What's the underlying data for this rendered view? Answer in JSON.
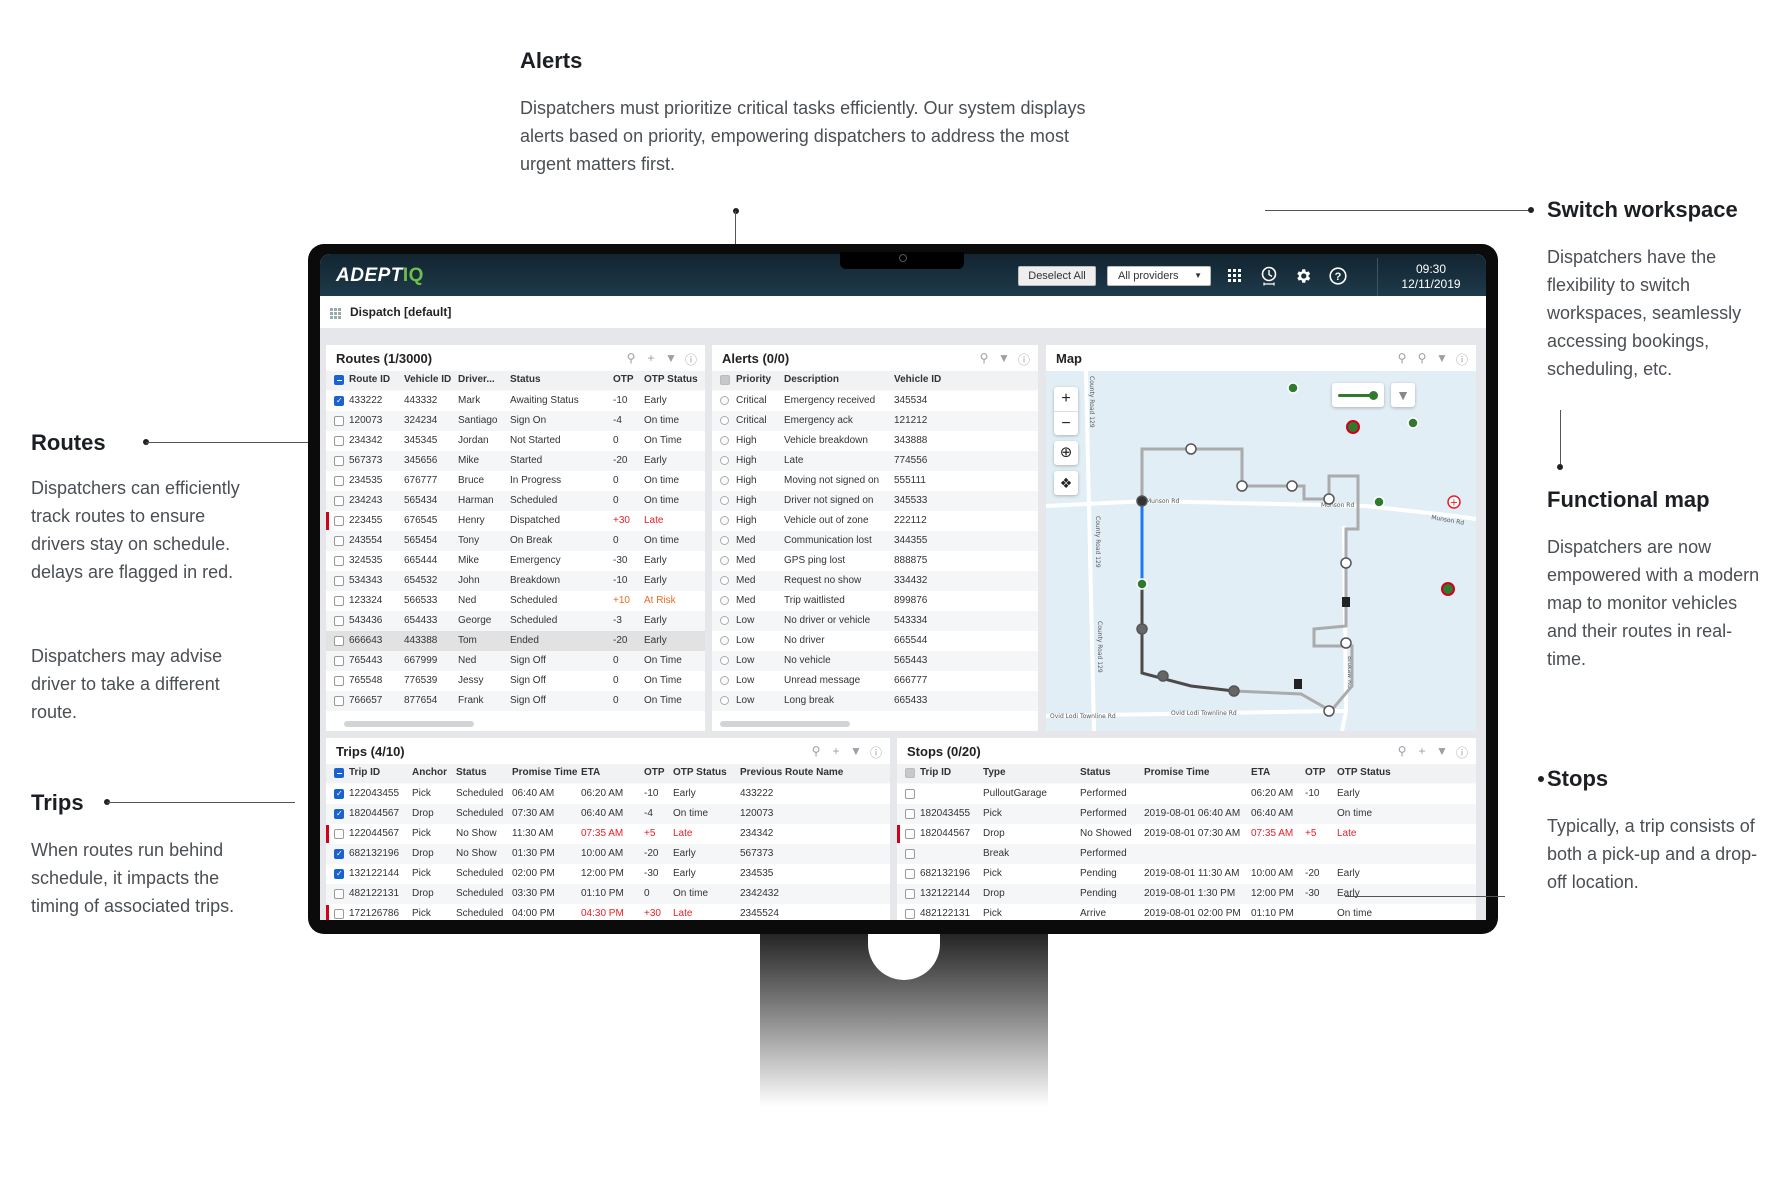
{
  "annotations": {
    "alerts": {
      "title": "Alerts",
      "body": "Dispatchers must prioritize critical tasks efficiently. Our system displays alerts based on priority, empowering dispatchers to address the most urgent matters first."
    },
    "switch_workspace": {
      "title": "Switch workspace",
      "body": "Dispatchers have the flexibility to switch workspaces, seamlessly accessing bookings, scheduling, etc."
    },
    "functional_map": {
      "title": "Functional map",
      "body": "Dispatchers are now empowered with a modern map to monitor vehicles and their routes in real-time."
    },
    "routes": {
      "title": "Routes",
      "body1": "Dispatchers can efficiently track routes to ensure drivers stay on schedule. delays are flagged in red.",
      "body2": "Dispatchers may advise driver to take a different route."
    },
    "trips": {
      "title": "Trips",
      "body": "When routes run behind schedule, it impacts the timing of associated trips."
    },
    "stops": {
      "title": "Stops",
      "body": "Typically, a trip consists of both a pick-up and a drop-off location."
    }
  },
  "header": {
    "logo_main": "ADEPT",
    "logo_accent": "IQ",
    "deselect_all": "Deselect All",
    "providers": "All providers",
    "time": "09:30",
    "date": "12/11/2019",
    "icons": [
      "apps-grid-icon",
      "timeline-clock-icon",
      "gear-icon",
      "help-icon"
    ]
  },
  "workspace": {
    "title": "Dispatch [default]"
  },
  "colors": {
    "accent": "#6cc04a",
    "late": "#e8202a",
    "at_risk": "#f06a1d",
    "selected": "#1b62d1",
    "header_bg": "#1a3140"
  },
  "routes": {
    "title": "Routes (1/3000)",
    "columns": [
      "Route ID",
      "Vehicle ID",
      "Driver...",
      "Status",
      "OTP",
      "OTP Status"
    ],
    "rows": [
      {
        "checked": true,
        "flag": false,
        "id": "433222",
        "vehicle": "443332",
        "driver": "Mark",
        "status": "Awaiting Status",
        "otp": "-10",
        "otp_status": "Early",
        "tone": ""
      },
      {
        "checked": false,
        "flag": false,
        "id": "120073",
        "vehicle": "324234",
        "driver": "Santiago",
        "status": "Sign On",
        "otp": "-4",
        "otp_status": "On time",
        "tone": ""
      },
      {
        "checked": false,
        "flag": false,
        "id": "234342",
        "vehicle": "345345",
        "driver": "Jordan",
        "status": "Not Started",
        "otp": "0",
        "otp_status": "On Time",
        "tone": ""
      },
      {
        "checked": false,
        "flag": false,
        "id": "567373",
        "vehicle": "345656",
        "driver": "Mike",
        "status": "Started",
        "otp": "-20",
        "otp_status": "Early",
        "tone": ""
      },
      {
        "checked": false,
        "flag": false,
        "id": "234535",
        "vehicle": "676777",
        "driver": "Bruce",
        "status": "In Progress",
        "otp": "0",
        "otp_status": "On time",
        "tone": ""
      },
      {
        "checked": false,
        "flag": false,
        "id": "234243",
        "vehicle": "565434",
        "driver": "Harman",
        "status": "Scheduled",
        "otp": "0",
        "otp_status": "On time",
        "tone": ""
      },
      {
        "checked": false,
        "flag": true,
        "id": "223455",
        "vehicle": "676545",
        "driver": "Henry",
        "status": "Dispatched",
        "otp": "+30",
        "otp_status": "Late",
        "tone": "late"
      },
      {
        "checked": false,
        "flag": false,
        "id": "243554",
        "vehicle": "565454",
        "driver": "Tony",
        "status": "On Break",
        "otp": "0",
        "otp_status": "On time",
        "tone": ""
      },
      {
        "checked": false,
        "flag": false,
        "id": "324535",
        "vehicle": "665444",
        "driver": "Mike",
        "status": "Emergency",
        "otp": "-30",
        "otp_status": "Early",
        "tone": ""
      },
      {
        "checked": false,
        "flag": false,
        "id": "534343",
        "vehicle": "654532",
        "driver": "John",
        "status": "Breakdown",
        "otp": "-10",
        "otp_status": "Early",
        "tone": ""
      },
      {
        "checked": false,
        "flag": false,
        "id": "123324",
        "vehicle": "566533",
        "driver": "Ned",
        "status": "Scheduled",
        "otp": "+10",
        "otp_status": "At Risk",
        "tone": "risk"
      },
      {
        "checked": false,
        "flag": false,
        "id": "543436",
        "vehicle": "654433",
        "driver": "George",
        "status": "Scheduled",
        "otp": "-3",
        "otp_status": "Early",
        "tone": ""
      },
      {
        "checked": false,
        "flag": false,
        "id": "666643",
        "vehicle": "443388",
        "driver": "Tom",
        "status": "Ended",
        "otp": "-20",
        "otp_status": "Early",
        "tone": "",
        "ended": true
      },
      {
        "checked": false,
        "flag": false,
        "id": "765443",
        "vehicle": "667999",
        "driver": "Ned",
        "status": "Sign Off",
        "otp": "0",
        "otp_status": "On Time",
        "tone": ""
      },
      {
        "checked": false,
        "flag": false,
        "id": "765548",
        "vehicle": "776539",
        "driver": "Jessy",
        "status": "Sign Off",
        "otp": "0",
        "otp_status": "On Time",
        "tone": ""
      },
      {
        "checked": false,
        "flag": false,
        "id": "766657",
        "vehicle": "877654",
        "driver": "Frank",
        "status": "Sign Off",
        "otp": "0",
        "otp_status": "On Time",
        "tone": ""
      }
    ]
  },
  "alerts": {
    "title": "Alerts (0/0)",
    "columns": [
      "Priority",
      "Description",
      "Vehicle ID"
    ],
    "rows": [
      {
        "priority": "Critical",
        "description": "Emergency received",
        "vehicle": "345534"
      },
      {
        "priority": "Critical",
        "description": "Emergency ack",
        "vehicle": "121212"
      },
      {
        "priority": "High",
        "description": "Vehicle breakdown",
        "vehicle": "343888"
      },
      {
        "priority": "High",
        "description": "Late",
        "vehicle": "774556"
      },
      {
        "priority": "High",
        "description": "Moving not signed on",
        "vehicle": "555111"
      },
      {
        "priority": "High",
        "description": "Driver not signed on",
        "vehicle": "345533"
      },
      {
        "priority": "High",
        "description": "Vehicle out of zone",
        "vehicle": "222112"
      },
      {
        "priority": "Med",
        "description": "Communication lost",
        "vehicle": "344355"
      },
      {
        "priority": "Med",
        "description": "GPS ping lost",
        "vehicle": "888875"
      },
      {
        "priority": "Med",
        "description": "Request no show",
        "vehicle": "334432"
      },
      {
        "priority": "Med",
        "description": "Trip waitlisted",
        "vehicle": "899876"
      },
      {
        "priority": "Low",
        "description": "No driver or vehicle",
        "vehicle": "543334"
      },
      {
        "priority": "Low",
        "description": "No driver",
        "vehicle": "665544"
      },
      {
        "priority": "Low",
        "description": "No vehicle",
        "vehicle": "565443"
      },
      {
        "priority": "Low",
        "description": "Unread message",
        "vehicle": "666777"
      },
      {
        "priority": "Low",
        "description": "Long break",
        "vehicle": "665433"
      }
    ]
  },
  "map": {
    "title": "Map",
    "zoom_in": "+",
    "zoom_out": "−",
    "roads": {
      "munson": "Munson Rd",
      "county": "County Road 129",
      "ovid": "Ovid Lodi Townline Rd",
      "brokaw": "Brokaw Rd"
    }
  },
  "trips": {
    "title": "Trips (4/10)",
    "columns": [
      "Trip ID",
      "Anchor",
      "Status",
      "Promise Time",
      "ETA",
      "OTP",
      "OTP Status",
      "Previous Route Name"
    ],
    "rows": [
      {
        "checked": true,
        "flag": false,
        "id": "122043455",
        "anchor": "Pick",
        "status": "Scheduled",
        "promise": "06:40 AM",
        "eta": "06:20 AM",
        "otp": "-10",
        "otp_status": "Early",
        "prev": "433222",
        "tone": ""
      },
      {
        "checked": true,
        "flag": false,
        "id": "182044567",
        "anchor": "Drop",
        "status": "Scheduled",
        "promise": "07:30 AM",
        "eta": "06:40 AM",
        "otp": "-4",
        "otp_status": "On time",
        "prev": "120073",
        "tone": ""
      },
      {
        "checked": false,
        "flag": true,
        "id": "122044567",
        "anchor": "Pick",
        "status": "No Show",
        "promise": "11:30 AM",
        "eta": "07:35 AM",
        "otp": "+5",
        "otp_status": "Late",
        "prev": "234342",
        "tone": "late"
      },
      {
        "checked": true,
        "flag": false,
        "id": "682132196",
        "anchor": "Drop",
        "status": "No Show",
        "promise": "01:30 PM",
        "eta": "10:00 AM",
        "otp": "-20",
        "otp_status": "Early",
        "prev": "567373",
        "tone": ""
      },
      {
        "checked": true,
        "flag": false,
        "id": "132122144",
        "anchor": "Pick",
        "status": "Scheduled",
        "promise": "02:00 PM",
        "eta": "12:00 PM",
        "otp": "-30",
        "otp_status": "Early",
        "prev": "234535",
        "tone": ""
      },
      {
        "checked": false,
        "flag": false,
        "id": "482122131",
        "anchor": "Drop",
        "status": "Scheduled",
        "promise": "03:30 PM",
        "eta": "01:10 PM",
        "otp": "0",
        "otp_status": "On time",
        "prev": "2342432",
        "tone": ""
      },
      {
        "checked": false,
        "flag": true,
        "id": "172126786",
        "anchor": "Pick",
        "status": "Scheduled",
        "promise": "04:00 PM",
        "eta": "04:30 PM",
        "otp": "+30",
        "otp_status": "Late",
        "prev": "2345524",
        "tone": "late"
      }
    ]
  },
  "stops": {
    "title": "Stops (0/20)",
    "columns": [
      "Trip ID",
      "Type",
      "Status",
      "Promise Time",
      "ETA",
      "OTP",
      "OTP Status"
    ],
    "rows": [
      {
        "flag": false,
        "id": "",
        "type": "PulloutGarage",
        "status": "Performed",
        "promise": "",
        "eta": "06:20 AM",
        "otp": "-10",
        "otp_status": "Early",
        "tone": ""
      },
      {
        "flag": false,
        "id": "182043455",
        "type": "Pick",
        "status": "Performed",
        "promise": "2019-08-01 06:40 AM",
        "eta": "06:40 AM",
        "otp": "",
        "otp_status": "On time",
        "tone": ""
      },
      {
        "flag": true,
        "id": "182044567",
        "type": "Drop",
        "status": "No Showed",
        "promise": "2019-08-01 07:30 AM",
        "eta": "07:35 AM",
        "otp": "+5",
        "otp_status": "Late",
        "tone": "late"
      },
      {
        "flag": false,
        "id": "",
        "type": "Break",
        "status": "Performed",
        "promise": "",
        "eta": "",
        "otp": "",
        "otp_status": "",
        "tone": ""
      },
      {
        "flag": false,
        "id": "682132196",
        "type": "Pick",
        "status": "Pending",
        "promise": "2019-08-01 11:30 AM",
        "eta": "10:00 AM",
        "otp": "-20",
        "otp_status": "Early",
        "tone": ""
      },
      {
        "flag": false,
        "id": "132122144",
        "type": "Drop",
        "status": "Pending",
        "promise": "2019-08-01 1:30 PM",
        "eta": "12:00 PM",
        "otp": "-30",
        "otp_status": "Early",
        "tone": ""
      },
      {
        "flag": false,
        "id": "482122131",
        "type": "Pick",
        "status": "Arrive",
        "promise": "2019-08-01 02:00 PM",
        "eta": "01:10 PM",
        "otp": "",
        "otp_status": "On time",
        "tone": ""
      }
    ]
  }
}
